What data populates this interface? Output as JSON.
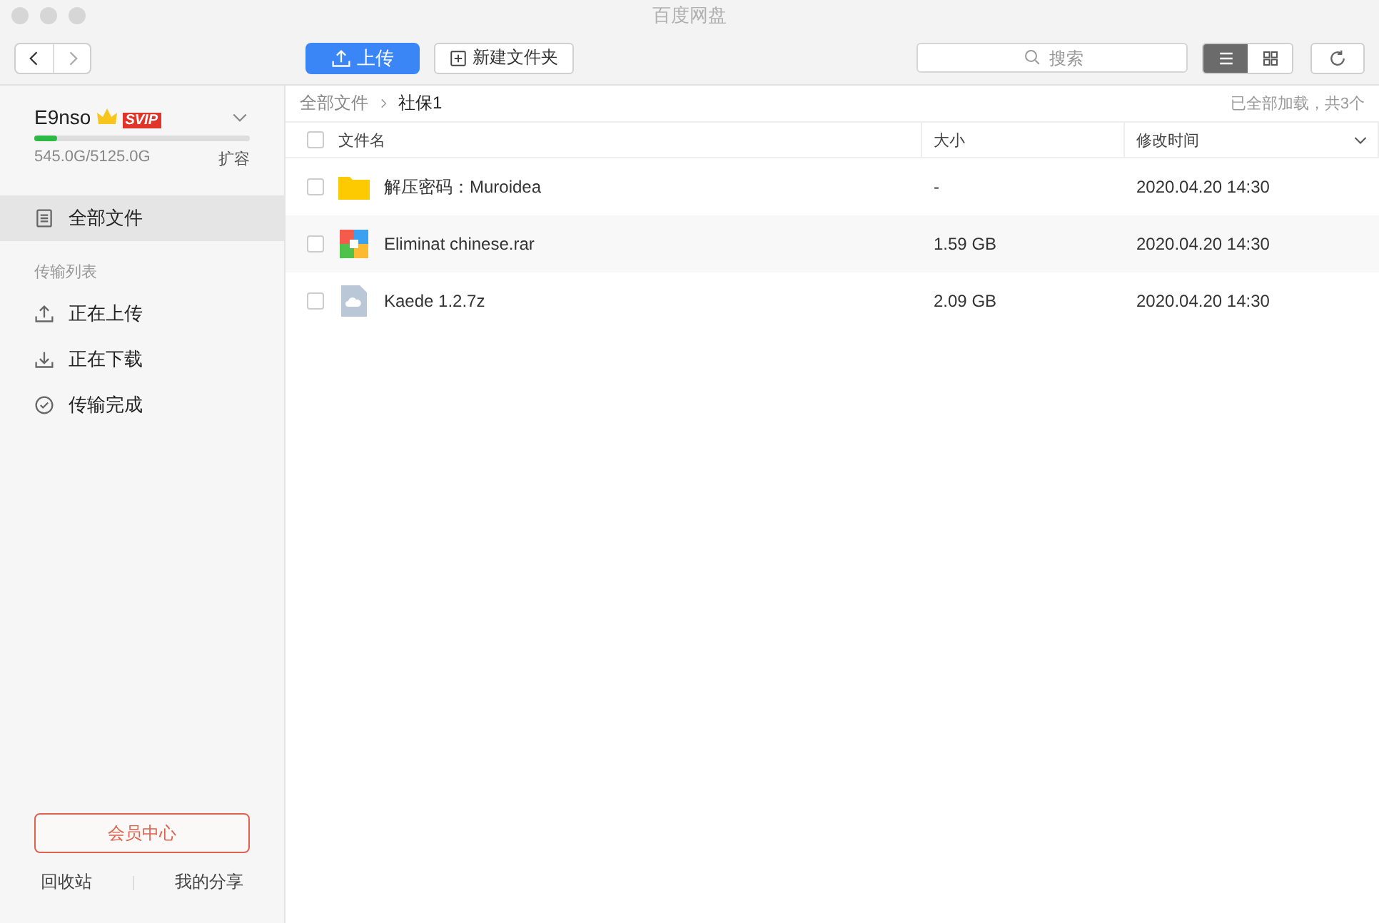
{
  "window": {
    "title": "百度网盘"
  },
  "toolbar": {
    "upload": "上传",
    "new_folder": "新建文件夹",
    "search": {
      "placeholder": "搜索"
    },
    "views": [
      {
        "kind": "list",
        "selected": true
      },
      {
        "kind": "grid",
        "selected": false
      }
    ]
  },
  "account": {
    "name": "E9nso",
    "badge": "SVIP",
    "usage": "545.0G/5125.0G",
    "level": 0.106,
    "expand": "扩容"
  },
  "sidebar": {
    "items": [
      {
        "kind": "files",
        "label": "全部文件",
        "selected": true
      }
    ],
    "section": "传输列表",
    "transfers": [
      {
        "kind": "upload",
        "label": "正在上传",
        "selected": false
      },
      {
        "kind": "download",
        "label": "正在下载",
        "selected": false
      },
      {
        "kind": "done",
        "label": "传输完成",
        "selected": false
      }
    ]
  },
  "vip_button": "会员中心",
  "footer_links": [
    "回收站",
    "我的分享"
  ],
  "breadcrumb": [
    "全部文件",
    "社保1"
  ],
  "status": "已全部加载，共3个",
  "table": {
    "select_all_checked": false,
    "columns": [
      "文件名",
      "大小",
      "修改时间"
    ],
    "rows": [
      {
        "kind": "folder",
        "name": "解压密码：Muroidea",
        "size": "-",
        "modified": "2020.04.20 14:30",
        "checked": false
      },
      {
        "kind": "archive",
        "name": "Eliminat chinese.rar",
        "size": "1.59 GB",
        "modified": "2020.04.20 14:30",
        "checked": false
      },
      {
        "kind": "cloud",
        "name": "Kaede 1.2.7z",
        "size": "2.09 GB",
        "modified": "2020.04.20 14:30",
        "checked": false
      }
    ]
  }
}
